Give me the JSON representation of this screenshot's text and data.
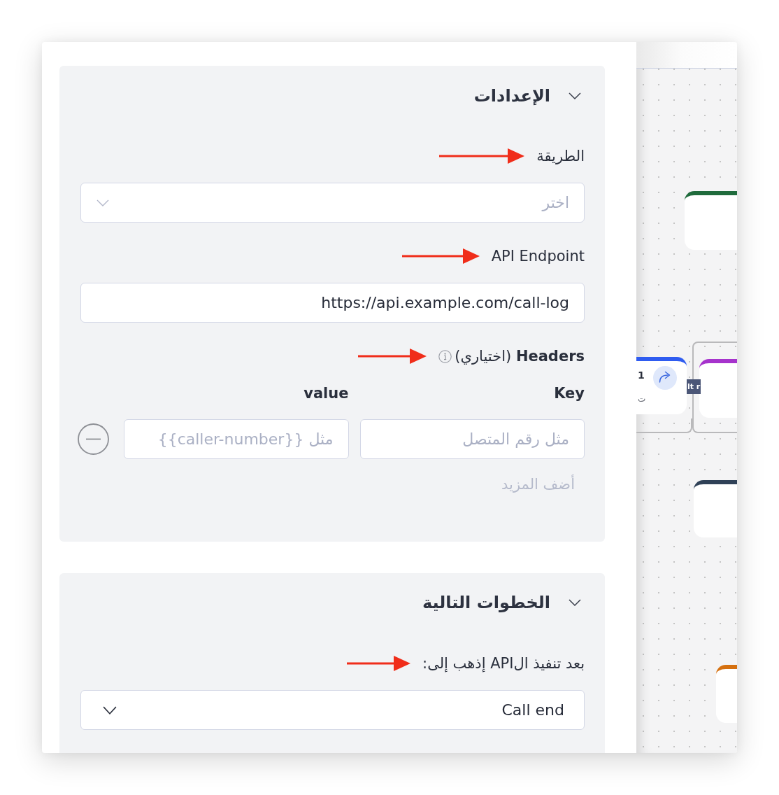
{
  "settings": {
    "title": "الإعدادات",
    "expanded": true,
    "method": {
      "label": "الطريقة",
      "annotated": true,
      "placeholder": "اختر"
    },
    "endpoint": {
      "label": "API Endpoint",
      "annotated": true,
      "value": "https://api.example.com/call-log"
    },
    "headers": {
      "label": "**Headers** (اختياري)",
      "annotated": true,
      "columns": [
        "Key",
        "value"
      ],
      "rows": [
        {
          "key_placeholder": "مثل رقم المتصل",
          "value_placeholder": "مثل {{caller-number}}"
        }
      ],
      "add_more": "أضف المزيد"
    }
  },
  "next_steps": {
    "title": "الخطوات التالية",
    "expanded": true,
    "destination": {
      "label": "بعد تنفيذ الAPI إذهب إلى:",
      "annotated": true,
      "value": "Call end"
    }
  },
  "canvas": {
    "nodes": [
      {
        "kind": "blank",
        "color": "#1f6b3c"
      },
      {
        "kind": "action",
        "color": "#2f5cf0",
        "title": "1",
        "subtitle": "ت"
      },
      {
        "kind": "blank",
        "color": "#a633cc"
      },
      {
        "kind": "blank",
        "color": "#2f4157"
      },
      {
        "kind": "blank",
        "color": "#d5700f"
      }
    ],
    "route_label": "lt r"
  }
}
